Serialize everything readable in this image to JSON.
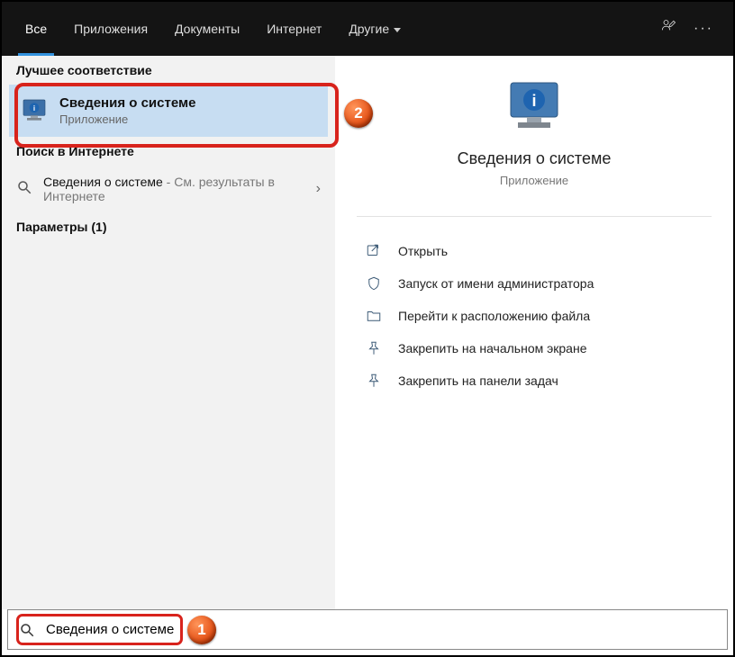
{
  "topbar": {
    "tabs": {
      "all": "Все",
      "apps": "Приложения",
      "docs": "Документы",
      "web": "Интернет",
      "other": "Другие"
    }
  },
  "left": {
    "best_header": "Лучшее соответствие",
    "best_title": "Сведения о системе",
    "best_sub": "Приложение",
    "web_header": "Поиск в Интернете",
    "web_name": "Сведения о системе",
    "web_suffix": " - См. результаты в Интернете",
    "settings_header": "Параметры (1)"
  },
  "preview": {
    "title": "Сведения о системе",
    "sub": "Приложение"
  },
  "actions": {
    "open": "Открыть",
    "admin": "Запуск от имени администратора",
    "goto": "Перейти к расположению файла",
    "pin_start": "Закрепить на начальном экране",
    "pin_taskbar": "Закрепить на панели задач"
  },
  "search": {
    "value": "Сведения о системе"
  },
  "annotations": {
    "m1": "1",
    "m2": "2"
  }
}
